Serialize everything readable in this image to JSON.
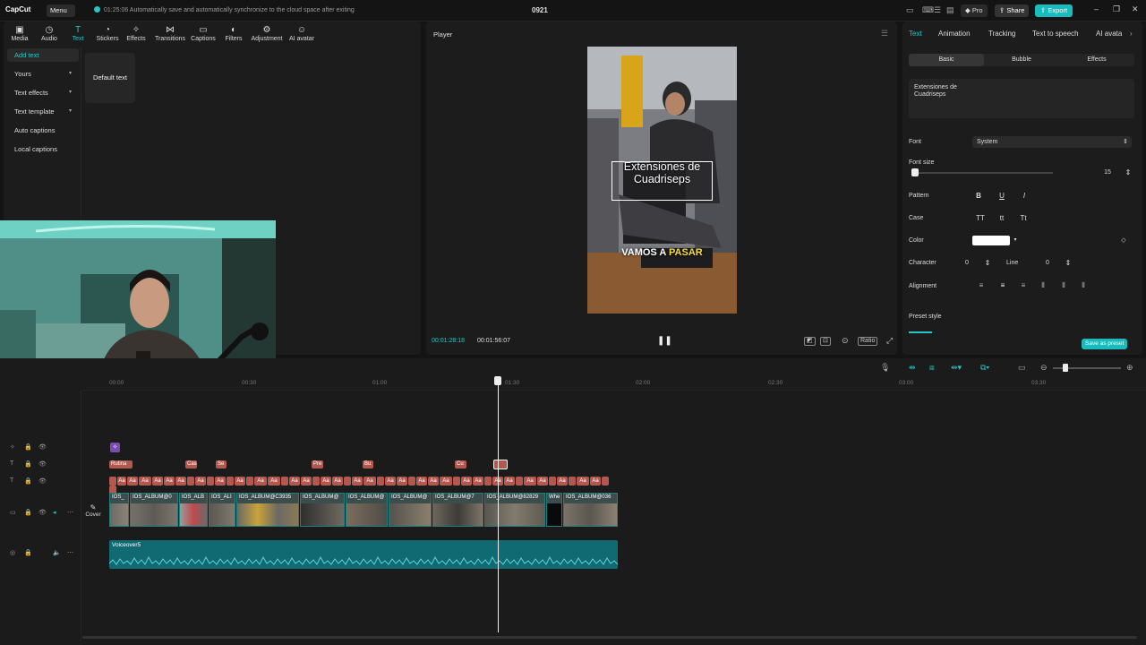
{
  "topbar": {
    "logo": "CapCut",
    "menu": "Menu",
    "save_status": "01:25:06 Automatically save and automatically synchronize to the cloud space after exiting",
    "project_name": "0921",
    "pro": "Pro",
    "share": "Share",
    "export": "Export"
  },
  "toolbar": {
    "tabs": [
      "Media",
      "Audio",
      "Text",
      "Stickers",
      "Effects",
      "Transitions",
      "Captions",
      "Filters",
      "Adjustment",
      "AI avatar"
    ]
  },
  "sidebar": {
    "items": [
      "Add text",
      "Yours",
      "Text effects",
      "Text template",
      "Auto captions",
      "Local captions"
    ]
  },
  "content": {
    "default_text": "Default text"
  },
  "webcam": {
    "tag": "logi"
  },
  "player": {
    "title": "Player",
    "overlay_line1": "Extensiones de",
    "overlay_line2": "Cuadriseps",
    "caption_a": "VAMOS A",
    "caption_b": "PASAR",
    "time_current": "00:01:28:18",
    "time_total": "00:01:56:07",
    "ratio": "Ratio"
  },
  "inspector": {
    "tabs": [
      "Text",
      "Animation",
      "Tracking",
      "Text to speech",
      "AI avata"
    ],
    "subtabs": [
      "Basic",
      "Bubble",
      "Effects"
    ],
    "text_line1": "Extensiones de",
    "text_line2": "Cuadriseps",
    "font_label": "Font",
    "font_value": "System",
    "font_size_label": "Font size",
    "font_size_value": "15",
    "pattern_label": "Pattern",
    "case_label": "Case",
    "color_label": "Color",
    "character_label": "Character",
    "character_value": "0",
    "line_label": "Line",
    "line_value": "0",
    "alignment_label": "Alignment",
    "preset_label": "Preset style",
    "save_preset": "Save as preset",
    "pattern_b": "B",
    "pattern_u": "U",
    "pattern_i": "I",
    "case_upper": "TT",
    "case_lower": "tt",
    "case_title": "Tt"
  },
  "timeline": {
    "ruler": [
      "00:00",
      "00:30",
      "01:00",
      "01:30",
      "02:00",
      "02:30",
      "03:00",
      "03:30"
    ],
    "text_clips": [
      "Rutina",
      "Cas",
      "Se",
      "Pre",
      "Bu",
      "Cu"
    ],
    "video_clips": [
      "IOS_",
      "IOS_ALBUM@0",
      "IOS_ALB",
      "IOS_ALI",
      "IOS_ALBUM@C3935",
      "IOS_ALBUM@",
      "IOS_ALBUM@",
      "IOS_ALBUM@",
      "IOS_ALBUM@7",
      "IOS_ALBUM@82829",
      "Whe",
      "IOS_ALBUM@036"
    ],
    "audio_clip": "Voiceover5",
    "cover": "Cover",
    "mini_clip": "Aa"
  }
}
